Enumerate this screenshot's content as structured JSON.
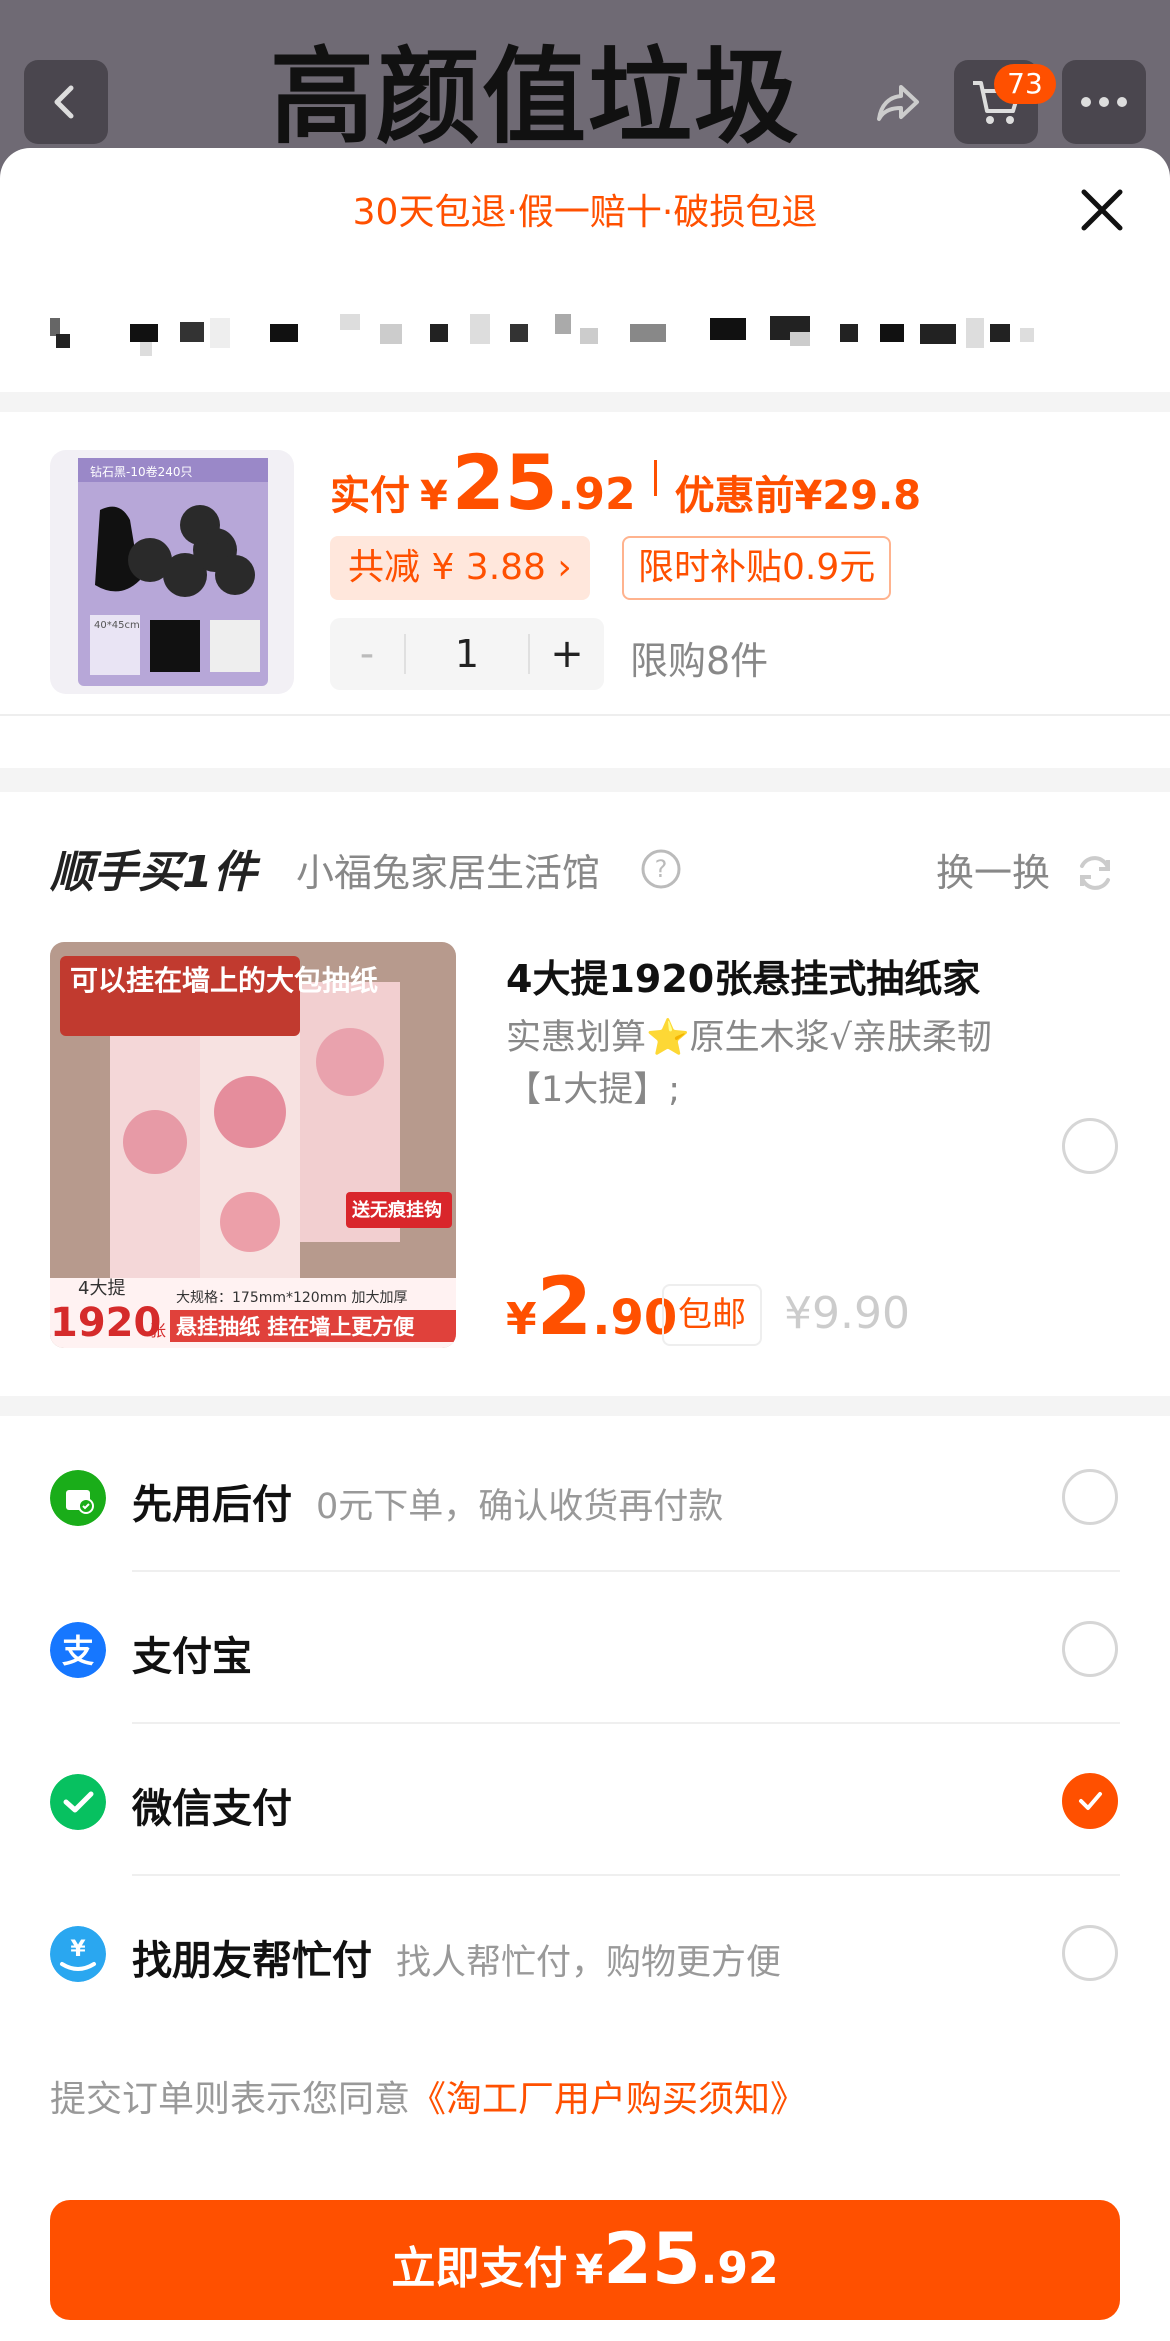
{
  "topbar": {
    "title": "高颜值垃圾袋",
    "cart_count": "73"
  },
  "sheet": {
    "promise": "30天包退·假一赔十·破损包退"
  },
  "product": {
    "pay_label": "实付",
    "currency": "¥",
    "price_int": "25",
    "price_dec": ".92",
    "before_label": "优惠前",
    "before_price": "¥29.8",
    "saved_label": "共减 ¥ 3.88 ›",
    "subsidy_label": "限时补贴0.9元",
    "quantity": "1",
    "minus": "-",
    "plus": "+",
    "limit": "限购8件",
    "image_texts": [
      "钻石黑-10卷240只",
      "40*45cm"
    ]
  },
  "addon": {
    "title": "顺手买1件",
    "shop": "小福兔家居生活馆",
    "swap": "换一换",
    "name": "4大提1920张悬挂式抽纸家",
    "desc": "实惠划算⭐原生木浆√亲肤柔韧【1大提】;",
    "currency": "¥",
    "price_int": "2",
    "price_dec": ".90",
    "free_ship": "包邮",
    "orig_price": "¥9.90",
    "image_texts": {
      "banner": "可以挂在墙上的大包抽纸",
      "gift": "送无痕挂钩",
      "count_label": "4大提",
      "count": "1920",
      "unit": "张",
      "spec": "大规格：175mm*120mm 加大加厚",
      "slogan": "悬挂抽纸 挂在墙上更方便"
    }
  },
  "payments": [
    {
      "name": "先用后付",
      "sub": "0元下单，确认收货再付款",
      "icon": "pay-later-icon",
      "color": "#1aad19",
      "checked": false
    },
    {
      "name": "支付宝",
      "sub": "",
      "icon": "alipay-icon",
      "color": "#1677ff",
      "checked": false
    },
    {
      "name": "微信支付",
      "sub": "",
      "icon": "wechat-pay-icon",
      "color": "#07c160",
      "checked": true
    },
    {
      "name": "找朋友帮忙付",
      "sub": "找人帮忙付，购物更方便",
      "icon": "friend-pay-icon",
      "color": "#2aa7f0",
      "checked": false
    }
  ],
  "agreement": {
    "text": "提交订单则表示您同意",
    "link": "《淘工厂用户购买须知》"
  },
  "pay_button": {
    "label": "立即支付",
    "currency": "¥",
    "price_int": "25",
    "price_dec": ".92"
  },
  "colors": {
    "accent": "#ff5000"
  }
}
